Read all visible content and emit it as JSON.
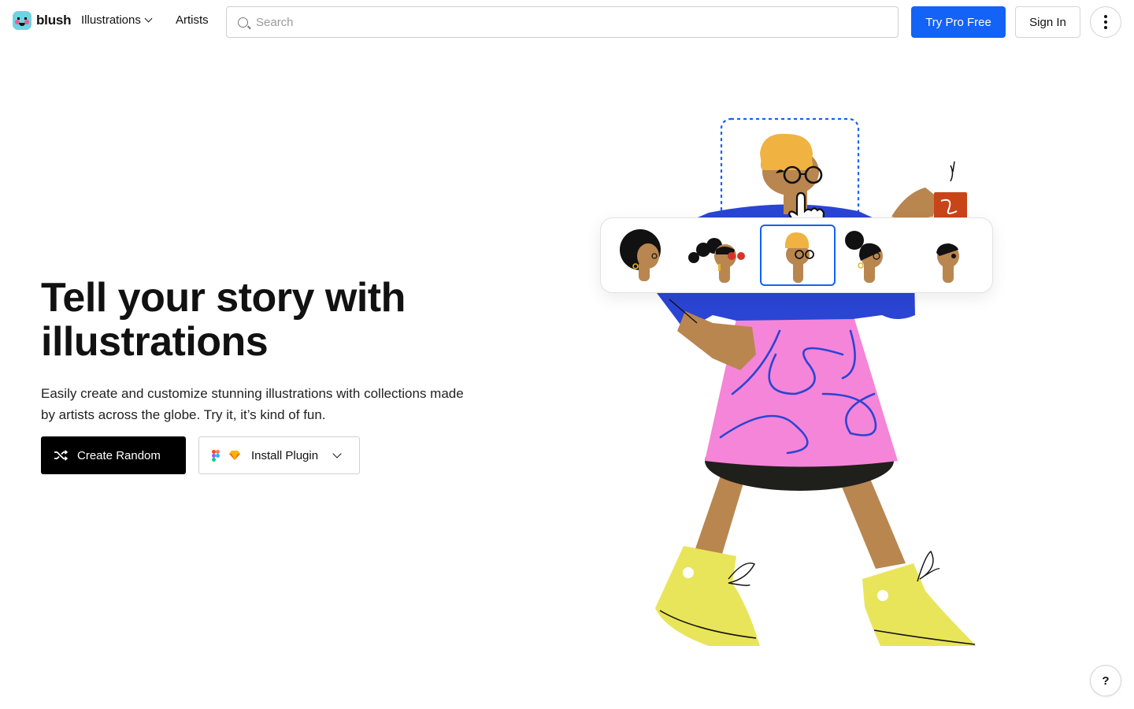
{
  "header": {
    "brand": "blush",
    "nav": [
      {
        "label": "Illustrations",
        "has_dropdown": true
      },
      {
        "label": "Artists",
        "has_dropdown": false
      }
    ],
    "search_placeholder": "Search",
    "try_pro_label": "Try Pro Free",
    "sign_in_label": "Sign In"
  },
  "hero": {
    "title": "Tell your story with illustrations",
    "subtitle": "Easily create and customize stunning illustrations with collections made by artists across the globe. Try it, it’s kind of fun.",
    "create_random_label": "Create Random",
    "install_plugin_label": "Install Plugin"
  },
  "help_label": "?",
  "colors": {
    "accent": "#1263f6",
    "shirt": "#2a45d4",
    "skirt": "#f585d8",
    "skin": "#b98650",
    "hat": "#f0b341",
    "shoes": "#e9e55a",
    "mug": "#c8451a"
  },
  "head_options": [
    {
      "name": "afro",
      "selected": false
    },
    {
      "name": "space-buns-sunglasses",
      "selected": false
    },
    {
      "name": "beanie-glasses",
      "selected": true
    },
    {
      "name": "high-bun",
      "selected": false
    },
    {
      "name": "short-hair",
      "selected": false
    }
  ]
}
